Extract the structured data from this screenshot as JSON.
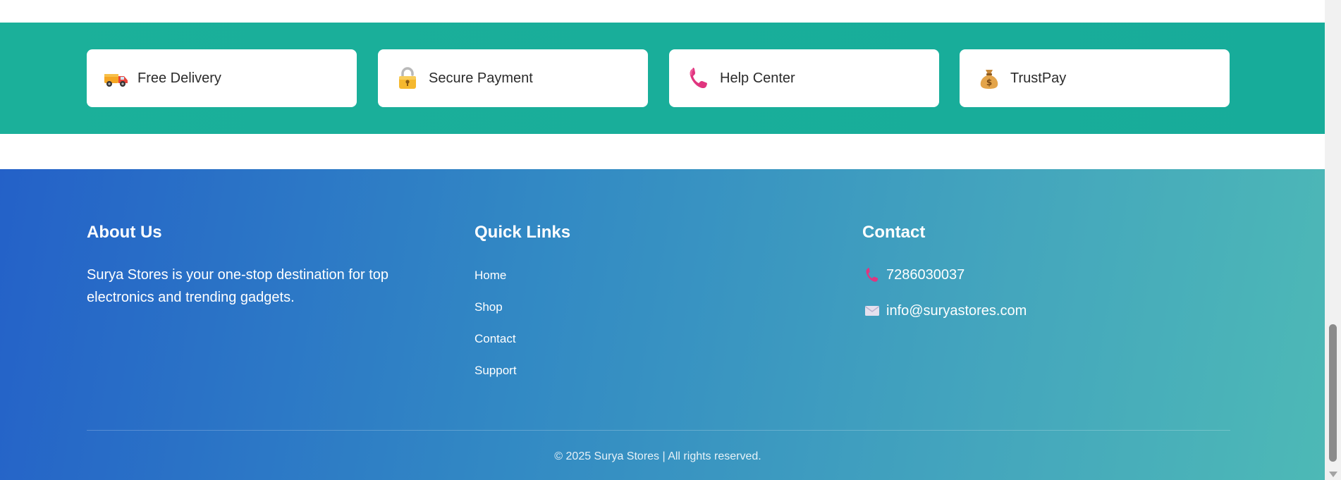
{
  "features": [
    {
      "label": "Free Delivery",
      "icon": "delivery-truck-icon"
    },
    {
      "label": "Secure Payment",
      "icon": "lock-icon"
    },
    {
      "label": "Help Center",
      "icon": "phone-icon"
    },
    {
      "label": "TrustPay",
      "icon": "money-bag-icon"
    }
  ],
  "footer": {
    "about": {
      "title": "About Us",
      "text": "Surya Stores is your one-stop destination for top electronics and trending gadgets."
    },
    "quick_links": {
      "title": "Quick Links",
      "links": [
        "Home",
        "Shop",
        "Contact",
        "Support"
      ]
    },
    "contact": {
      "title": "Contact",
      "phone": "7286030037",
      "email": "info@suryastores.com"
    },
    "copyright": "© 2025 Surya Stores | All rights reserved."
  },
  "colors": {
    "features_band": "#17ac9a",
    "footer_gradient_start": "#2461c8",
    "footer_gradient_end": "#4db9b6"
  }
}
